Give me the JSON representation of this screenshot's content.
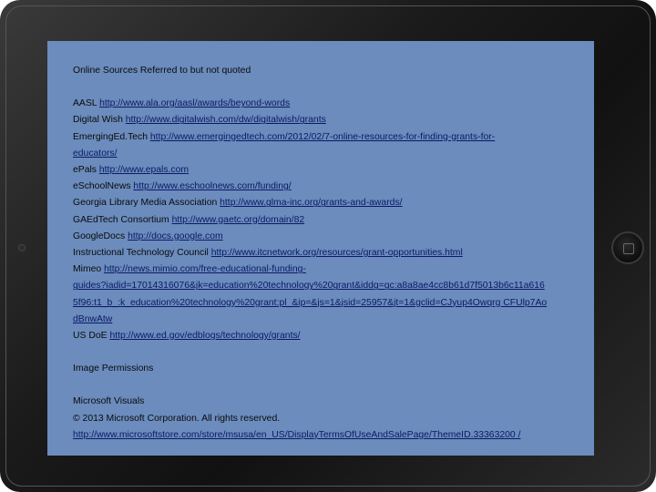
{
  "heading": "Online Sources Referred to but not quoted",
  "sources": [
    {
      "name": "AASL",
      "url": "http://www.ala.org/aasl/awards/beyond-words"
    },
    {
      "name": "Digital Wish",
      "url": "http://www.digitalwish.com/dw/digitalwish/grants"
    },
    {
      "name": "EmergingEd.Tech",
      "url_line1": "http://www.emergingedtech.com/2012/02/7-online-resources-for-finding-grants-for-",
      "url_line2": "educators/"
    },
    {
      "name": "ePals",
      "url": "http://www.epals.com"
    },
    {
      "name": "eSchoolNews",
      "url": "http://www.eschoolnews.com/funding/"
    },
    {
      "name": "Georgia Library Media Association",
      "url": "http://www.glma-inc.org/grants-and-awards/"
    },
    {
      "name": "GAEdTech Consortium",
      "url": "http://www.gaetc.org/domain/82"
    },
    {
      "name": "GoogleDocs",
      "url": "http://docs.google.com"
    },
    {
      "name": "Instructional Technology Council",
      "url": "http://www.itcnetwork.org/resources/grant-opportunities.html"
    },
    {
      "name": "Mimeo",
      "url_line1": "http://news.mimio.com/free-educational-funding-",
      "url_line2": "guides?iadid=17014316076&jk=education%20technology%20grant&iddg=gc:a8a8ae4cc8b61d7f5013b6c11a616",
      "url_line3": "5f96:t1_b_:k_education%20technology%20grant:pl_&ip=&js=1&jsid=25957&jt=1&gclid=CJyup4Owqrg CFUlp7Ao",
      "url_line4": "dBnwAtw"
    },
    {
      "name": "US DoE",
      "url": "http://www.ed.gov/edblogs/technology/grants/"
    }
  ],
  "permissions_heading": "Image Permissions",
  "visuals_title": "Microsoft Visuals",
  "copyright": "© 2013 Microsoft Corporation. All rights reserved.",
  "terms_url": "http://www.microsoftstore.com/store/msusa/en_US/DisplayTermsOfUseAndSalePage/ThemeID.33363200 /",
  "colors": {
    "screen": "#6b8cbd",
    "bezel": "#1a1a1a",
    "link": "#0b1a66"
  }
}
